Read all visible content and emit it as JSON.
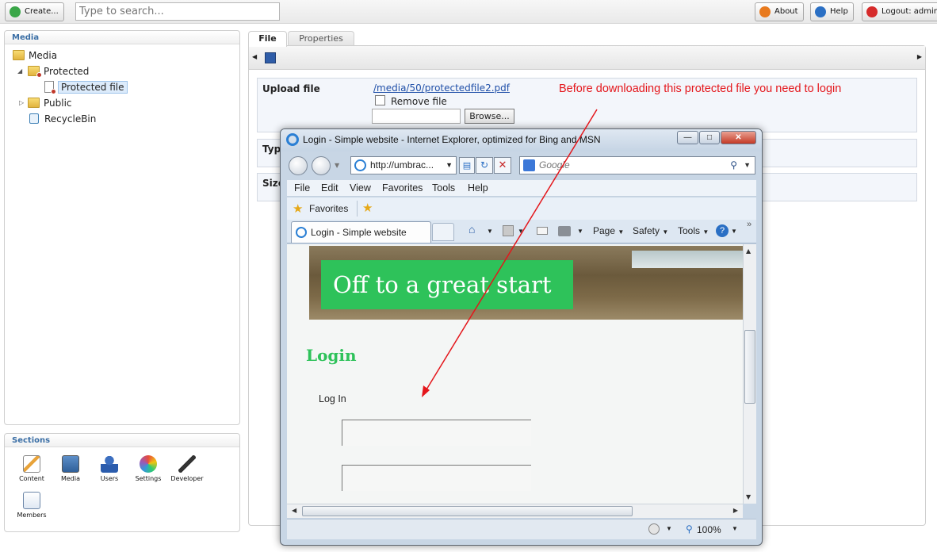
{
  "toolbar": {
    "create_label": "Create...",
    "search_placeholder": "Type to search...",
    "about_label": "About",
    "help_label": "Help",
    "logout_label": "Logout: admin"
  },
  "media_panel": {
    "title": "Media",
    "tree": [
      {
        "label": "Media"
      },
      {
        "label": "Protected"
      },
      {
        "label": "Protected file",
        "selected": true
      },
      {
        "label": "Public"
      },
      {
        "label": "RecycleBin"
      }
    ]
  },
  "sections_panel": {
    "title": "Sections",
    "items": [
      {
        "label": "Content",
        "icon": "content-icon"
      },
      {
        "label": "Media",
        "icon": "media-icon"
      },
      {
        "label": "Users",
        "icon": "users-icon"
      },
      {
        "label": "Settings",
        "icon": "settings-icon"
      },
      {
        "label": "Developer",
        "icon": "developer-icon"
      },
      {
        "label": "Members",
        "icon": "members-icon"
      }
    ]
  },
  "editor": {
    "tabs": [
      {
        "label": "File",
        "active": true
      },
      {
        "label": "Properties",
        "active": false
      }
    ],
    "upload_label": "Upload file",
    "file_link": "/media/50/protectedfile2.pdf",
    "remove_file_label": "Remove file",
    "browse_label": "Browse...",
    "type_label": "Type",
    "size_label": "Size"
  },
  "annotation": {
    "text": "Before downloading this protected file you need to login",
    "color": "#e4161b"
  },
  "ie_window": {
    "title": "Login - Simple website - Internet Explorer, optimized for Bing and MSN",
    "address": "http://umbrac...",
    "search_placeholder": "Google",
    "menu": [
      "File",
      "Edit",
      "View",
      "Favorites",
      "Tools",
      "Help"
    ],
    "favorites_label": "Favorites",
    "tab_label": "Login - Simple website",
    "commands": [
      "Page",
      "Safety",
      "Tools"
    ],
    "zoom": "100%",
    "page": {
      "banner_text": "Off to a great start",
      "login_heading": "Login",
      "login_sub": "Log In",
      "accent_color": "#2ec25a"
    }
  }
}
